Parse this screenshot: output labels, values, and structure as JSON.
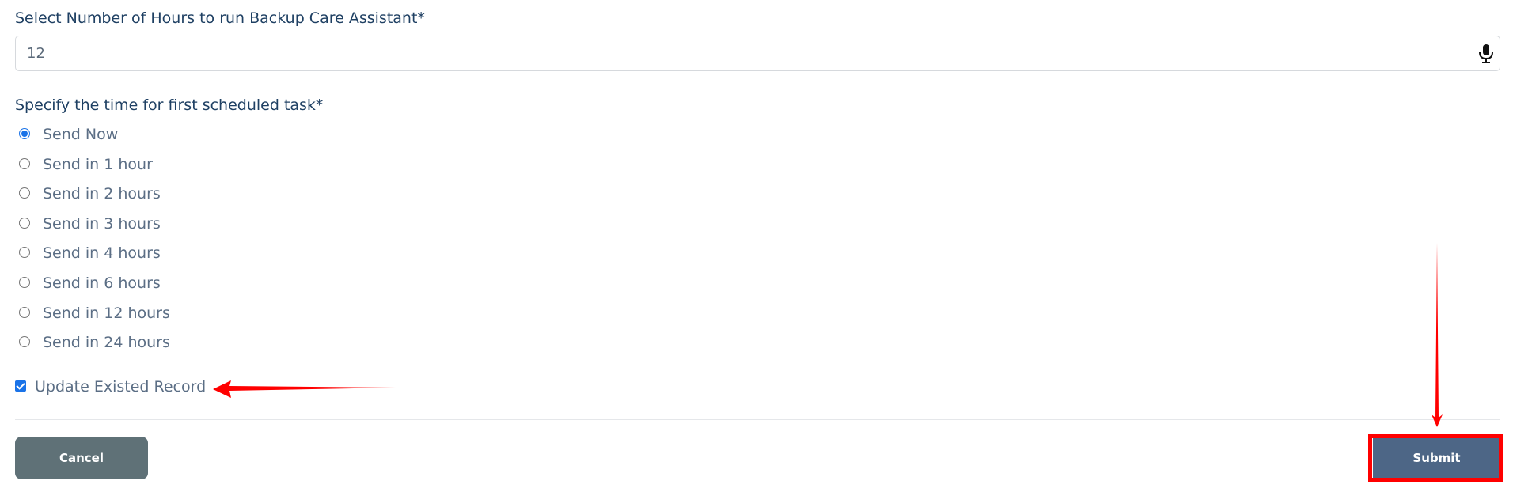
{
  "form": {
    "hours_label": "Select Number of Hours to run Backup Care Assistant*",
    "hours_value": "12",
    "time_label": "Specify the time for first scheduled task*",
    "options": [
      {
        "label": "Send Now",
        "checked": true
      },
      {
        "label": "Send in 1 hour",
        "checked": false
      },
      {
        "label": "Send in 2 hours",
        "checked": false
      },
      {
        "label": "Send in 3 hours",
        "checked": false
      },
      {
        "label": "Send in 4 hours",
        "checked": false
      },
      {
        "label": "Send in 6 hours",
        "checked": false
      },
      {
        "label": "Send in 12 hours",
        "checked": false
      },
      {
        "label": "Send in 24 hours",
        "checked": false
      }
    ],
    "update_label": "Update Existed Record",
    "update_checked": true
  },
  "buttons": {
    "cancel": "Cancel",
    "submit": "Submit"
  },
  "icons": {
    "mic": "microphone-icon"
  },
  "colors": {
    "heading": "#1f4063",
    "body_text": "#5b6e85",
    "cancel_bg": "#5f7177",
    "submit_bg": "#4d6686",
    "annotation": "#ff0000",
    "accent": "#1a73e8"
  }
}
